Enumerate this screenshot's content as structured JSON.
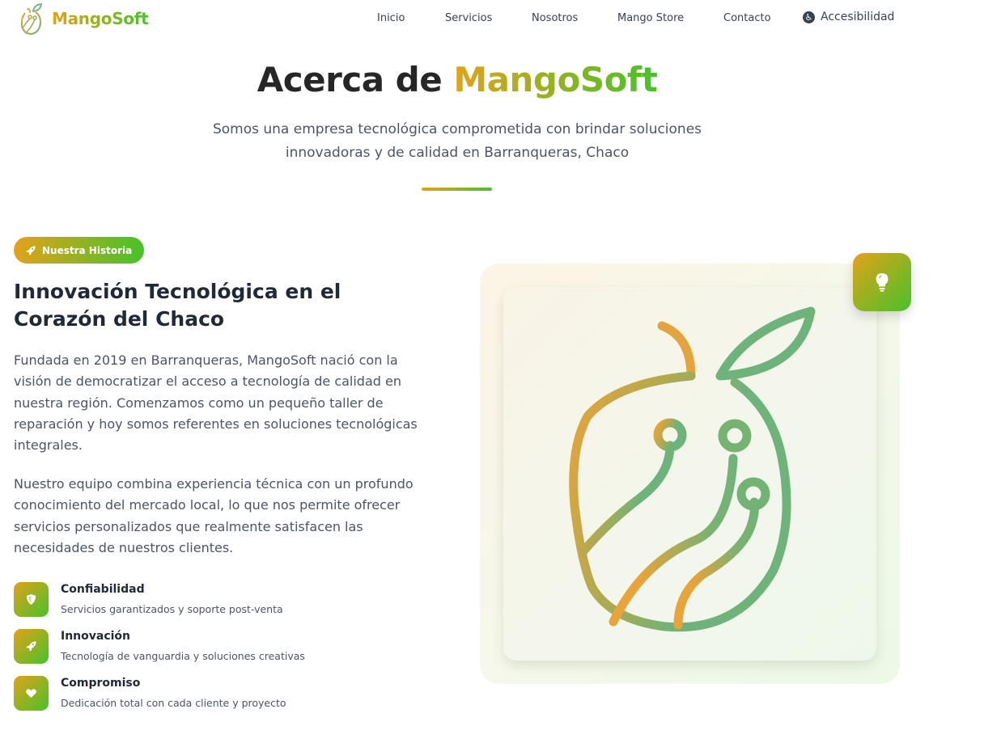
{
  "nav": {
    "brand": "MangoSoft",
    "links": [
      "Inicio",
      "Servicios",
      "Nosotros",
      "Mango Store",
      "Contacto"
    ],
    "accessibility": "Accesibilidad"
  },
  "hero": {
    "title_plain": "Acerca de",
    "title_accent": "MangoSoft",
    "subtitle_line1": "Somos una empresa tecnológica comprometida con brindar soluciones",
    "subtitle_line2": "innovadoras y de calidad en Barranqueras, Chaco"
  },
  "story": {
    "badge": "Nuestra Historia",
    "title_line1": "Innovación Tecnológica en el",
    "title_line2": "Corazón del Chaco",
    "paragraph1": "Fundada en 2019 en Barranqueras, MangoSoft nació con la visión de democratizar el acceso a tecnología de calidad en nuestra región. Comenzamos como un pequeño taller de reparación y hoy somos referentes en soluciones tecnológicas integrales.",
    "paragraph2": "Nuestro equipo combina experiencia técnica con un profundo conocimiento del mercado local, lo que nos permite ofrecer servicios personalizados que realmente satisfacen las necesidades de nuestros clientes."
  },
  "features": [
    {
      "title": "Confiabilidad",
      "desc": "Servicios garantizados y soporte post-venta",
      "icon": "shield-icon"
    },
    {
      "title": "Innovación",
      "desc": "Tecnología de vanguardia y soluciones creativas",
      "icon": "rocket-icon"
    },
    {
      "title": "Compromiso",
      "desc": "Dedicación total con cada cliente y proyecto",
      "icon": "heart-icon"
    }
  ],
  "colors": {
    "gradient_start": "#e2a21a",
    "gradient_end": "#47c22a",
    "illustration_orange": "#e8a33a",
    "illustration_green": "#6db37a"
  },
  "icons": {
    "logo": "mango-circuit-logo-icon",
    "accessibility": "accessibility-icon",
    "badge": "rocket-icon",
    "floating_tile": "lightbulb-icon",
    "illustration": "mango-circuit-illustration"
  }
}
